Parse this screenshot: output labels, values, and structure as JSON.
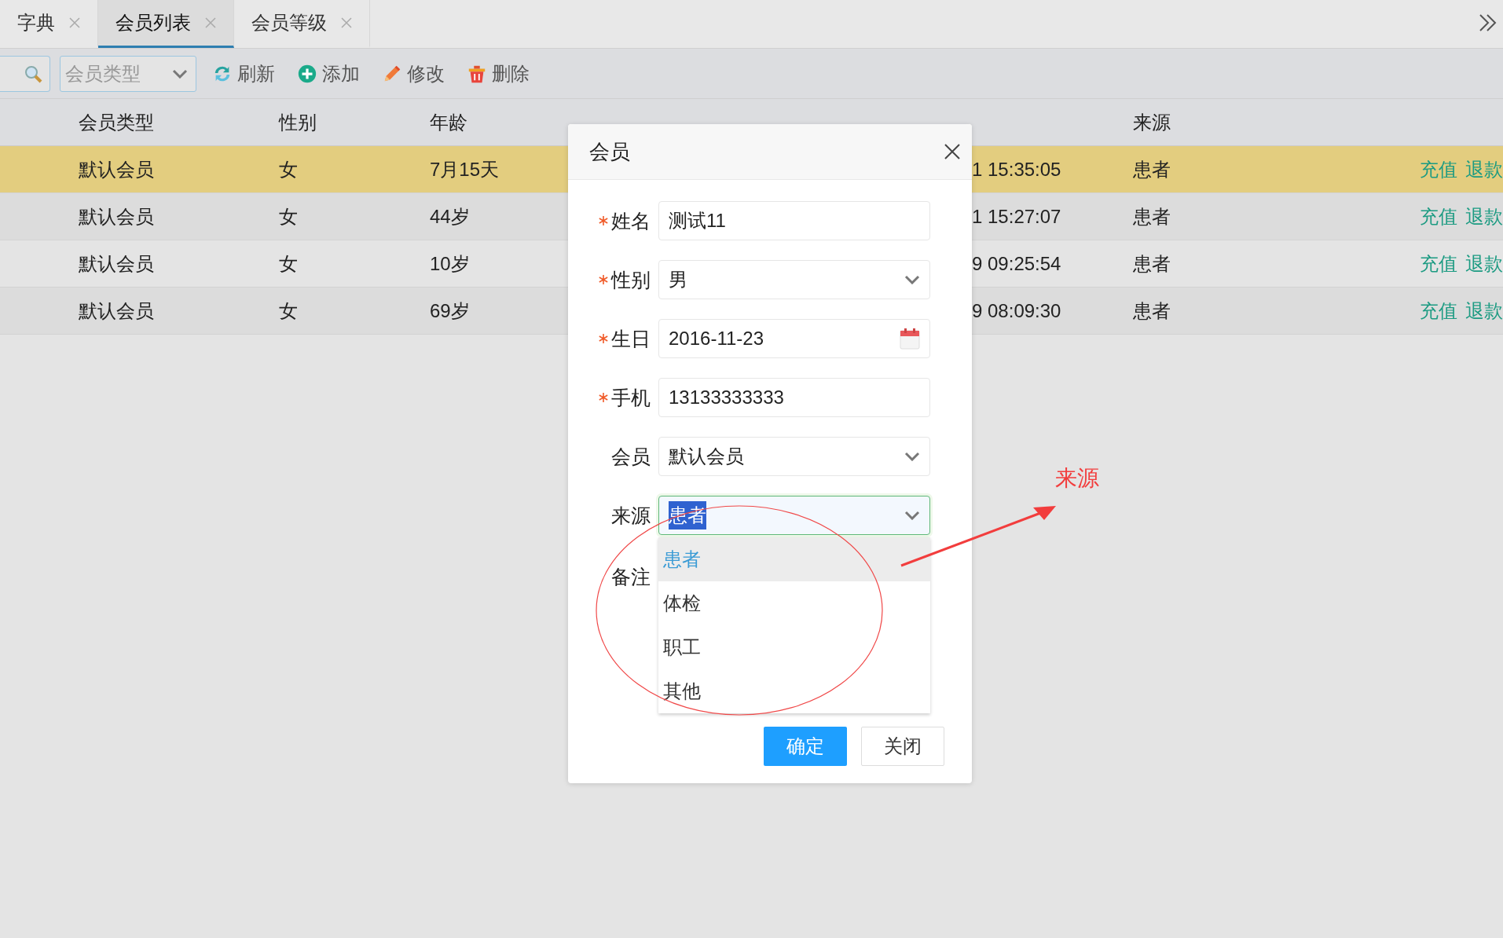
{
  "tabs": [
    {
      "label": "字典",
      "selected": false
    },
    {
      "label": "会员列表",
      "selected": true
    },
    {
      "label": "会员等级",
      "selected": false
    }
  ],
  "toolbar": {
    "type_select": {
      "placeholder": "会员类型"
    },
    "buttons": [
      {
        "kind": "refresh",
        "label": "刷新"
      },
      {
        "kind": "add",
        "label": "添加"
      },
      {
        "kind": "edit",
        "label": "修改"
      },
      {
        "kind": "delete",
        "label": "删除"
      }
    ]
  },
  "table": {
    "columns": [
      "会员类型",
      "性别",
      "年龄",
      "来源"
    ],
    "rows": [
      {
        "selected": true,
        "member_type": "默认会员",
        "gender": "女",
        "age": "7月15天",
        "open_date": "1 15:35:05",
        "source": "患者",
        "actions": [
          "充值",
          "退款"
        ]
      },
      {
        "selected": false,
        "member_type": "默认会员",
        "gender": "女",
        "age": "44岁",
        "open_date": "1 15:27:07",
        "source": "患者",
        "actions": [
          "充值",
          "退款"
        ]
      },
      {
        "selected": false,
        "member_type": "默认会员",
        "gender": "女",
        "age": "10岁",
        "open_date": "9 09:25:54",
        "source": "患者",
        "actions": [
          "充值",
          "退款"
        ]
      },
      {
        "selected": false,
        "member_type": "默认会员",
        "gender": "女",
        "age": "69岁",
        "open_date": "9 08:09:30",
        "source": "患者",
        "actions": [
          "充值",
          "退款"
        ]
      }
    ]
  },
  "dialog": {
    "title": "会员",
    "fields": [
      {
        "label": "姓名",
        "required": true,
        "kind": "text",
        "value": "测试11"
      },
      {
        "label": "性别",
        "required": true,
        "kind": "select",
        "value": "男"
      },
      {
        "label": "生日",
        "required": true,
        "kind": "date",
        "value": "2016-11-23"
      },
      {
        "label": "手机",
        "required": true,
        "kind": "text",
        "value": "13133333333"
      },
      {
        "label": "会员",
        "required": false,
        "kind": "select",
        "value": "默认会员"
      },
      {
        "label": "来源",
        "required": false,
        "kind": "select",
        "value": "患者",
        "focused": true,
        "options": [
          {
            "label": "患者",
            "selected": true
          },
          {
            "label": "体检",
            "selected": false
          },
          {
            "label": "职工",
            "selected": false
          },
          {
            "label": "其他",
            "selected": false
          }
        ]
      },
      {
        "label": "备注",
        "required": false,
        "kind": "textarea"
      }
    ],
    "buttons": [
      {
        "kind": "primary",
        "label": "确定"
      },
      {
        "kind": "default",
        "label": "关闭"
      }
    ]
  },
  "annotation": {
    "label": "来源"
  }
}
